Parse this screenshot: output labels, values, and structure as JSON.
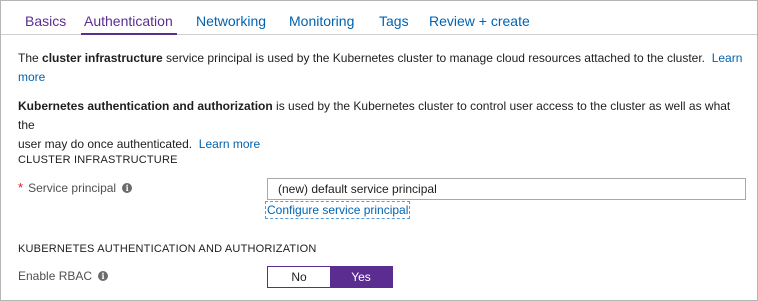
{
  "tabs": [
    {
      "label": "Basics"
    },
    {
      "label": "Authentication"
    },
    {
      "label": "Networking"
    },
    {
      "label": "Monitoring"
    },
    {
      "label": "Tags"
    },
    {
      "label": "Review + create"
    }
  ],
  "intro": {
    "p1_bold": "cluster infrastructure",
    "p1_prefix": "The ",
    "p1_rest": " service principal is used by the Kubernetes cluster to manage cloud resources attached to the cluster.",
    "p1_link_1": "Learn",
    "p1_link_2": "more",
    "p2_bold": "Kubernetes authentication and authorization",
    "p2_rest_1": " is used by the Kubernetes cluster to control user access to the cluster as well as what the",
    "p2_rest_2": "user may do once authenticated.",
    "p2_link": "Learn more"
  },
  "cluster_infrastructure": {
    "heading": "CLUSTER INFRASTRUCTURE",
    "required_mark": "*",
    "label": "Service principal",
    "value": "(new) default service principal",
    "configure_link": "Configure service principal"
  },
  "k8s_auth": {
    "heading": "KUBERNETES AUTHENTICATION AND AUTHORIZATION",
    "rbac_label": "Enable RBAC",
    "option_no": "No",
    "option_yes": "Yes",
    "selected": "Yes"
  },
  "icons": {
    "info": "info-icon"
  },
  "colors": {
    "accent": "#5c2d91",
    "link": "#0063b1",
    "required": "#e81123"
  }
}
